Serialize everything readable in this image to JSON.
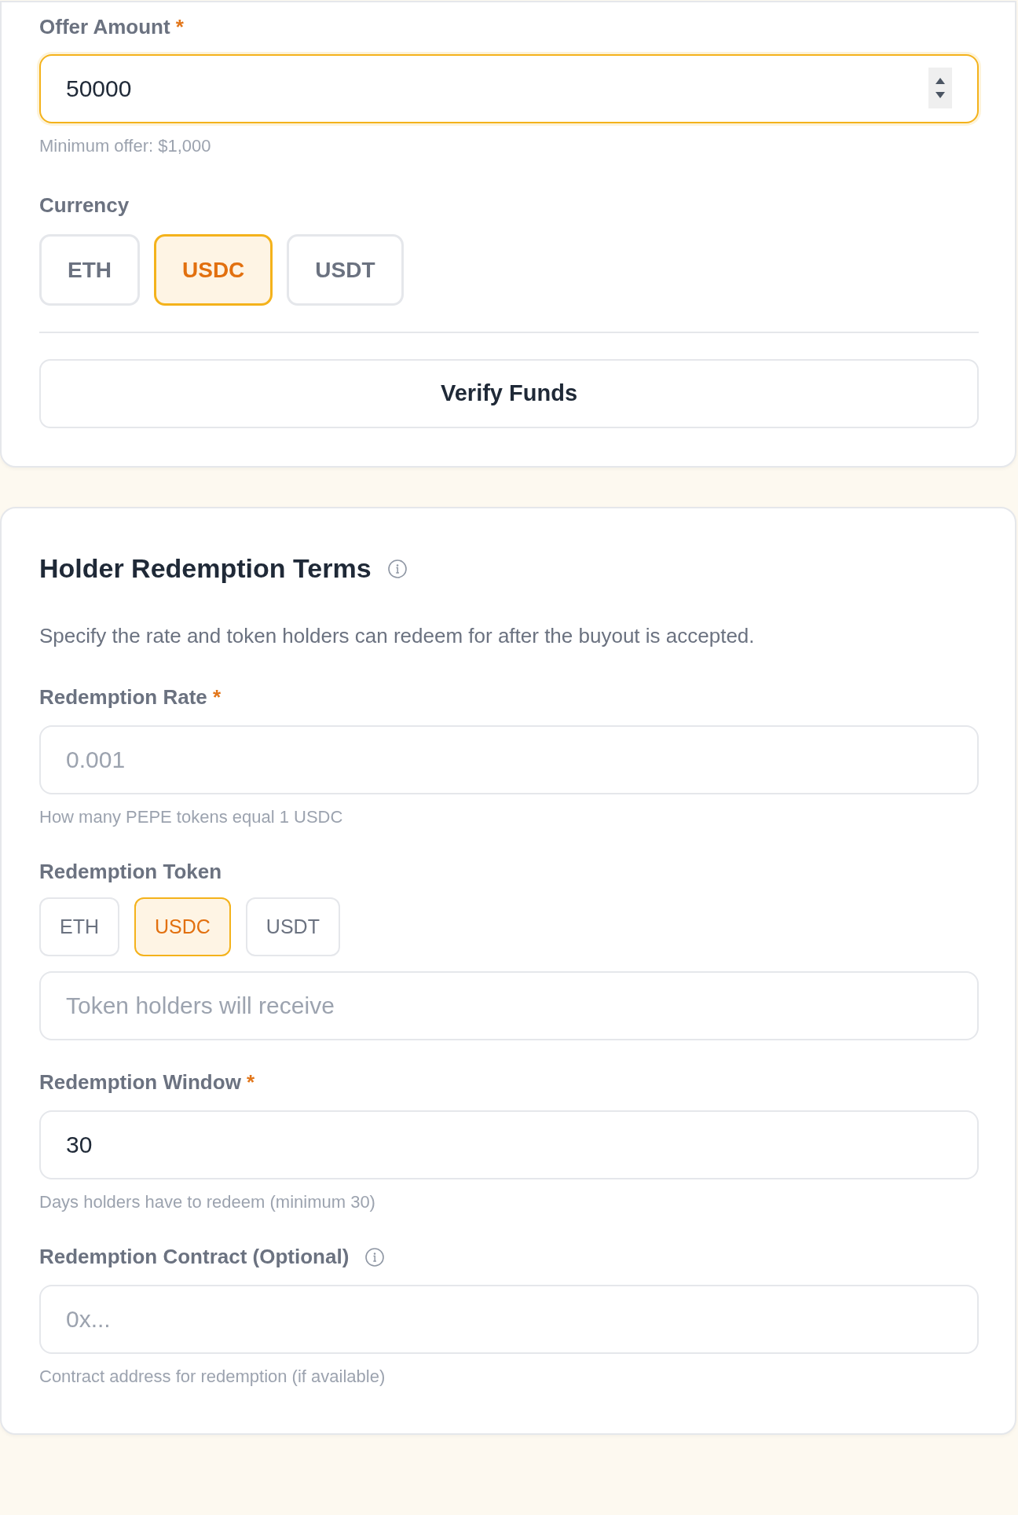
{
  "offer_section": {
    "offer_amount": {
      "label": "Offer Amount",
      "required_mark": "*",
      "value": "50000",
      "focused": true,
      "helper": "Minimum offer: $1,000"
    },
    "currency": {
      "label": "Currency",
      "options": [
        {
          "label": "ETH",
          "selected": false
        },
        {
          "label": "USDC",
          "selected": true
        },
        {
          "label": "USDT",
          "selected": false
        }
      ]
    },
    "verify_button": "Verify Funds"
  },
  "redemption_section": {
    "title": "Holder Redemption Terms",
    "info": true,
    "description": "Specify the rate and token holders can redeem for after the buyout is accepted.",
    "fields": [
      {
        "kind": "input",
        "label": "Redemption Rate",
        "required_mark": "*",
        "placeholder": "0.001",
        "helper": "How many PEPE tokens equal 1 USDC"
      },
      {
        "kind": "choice",
        "label": "Redemption Token",
        "options": [
          {
            "label": "ETH",
            "selected": false
          },
          {
            "label": "USDC",
            "selected": true
          },
          {
            "label": "USDT",
            "selected": false
          }
        ],
        "placeholder": "Token holders will receive"
      },
      {
        "kind": "input",
        "label": "Redemption Window",
        "required_mark": "*",
        "value": "30",
        "helper": "Days holders have to redeem (minimum 30)"
      },
      {
        "kind": "input",
        "label": "Redemption Contract (Optional)",
        "info": true,
        "placeholder": "0x...",
        "helper": "Contract address for redemption (if available)"
      }
    ]
  }
}
